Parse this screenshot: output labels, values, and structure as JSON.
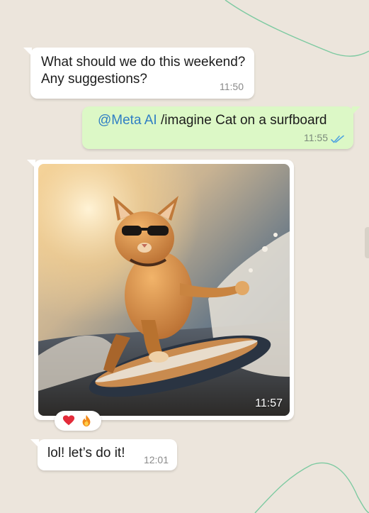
{
  "chat": {
    "messages": [
      {
        "direction": "incoming",
        "text": "What should we do this weekend?\nAny suggestions?",
        "time": "11:50"
      },
      {
        "direction": "outgoing",
        "mention": "@Meta AI",
        "text": " /imagine Cat on a surfboard",
        "time": "11:55",
        "status": "read",
        "status_icon": "double-check-icon"
      },
      {
        "direction": "incoming",
        "type": "image",
        "image_description": "cat-surfing-image",
        "time": "11:57",
        "reactions": [
          "heart-icon",
          "fire-icon"
        ]
      },
      {
        "direction": "incoming",
        "text": "lol! let’s do it!",
        "time": "12:01"
      }
    ]
  },
  "colors": {
    "background": "#ece5dc",
    "incoming_bubble": "#ffffff",
    "outgoing_bubble": "#dcf8c6",
    "mention": "#2f7ec4",
    "read_ticks": "#4fa3e0",
    "doodle_line": "#4fbf88"
  }
}
